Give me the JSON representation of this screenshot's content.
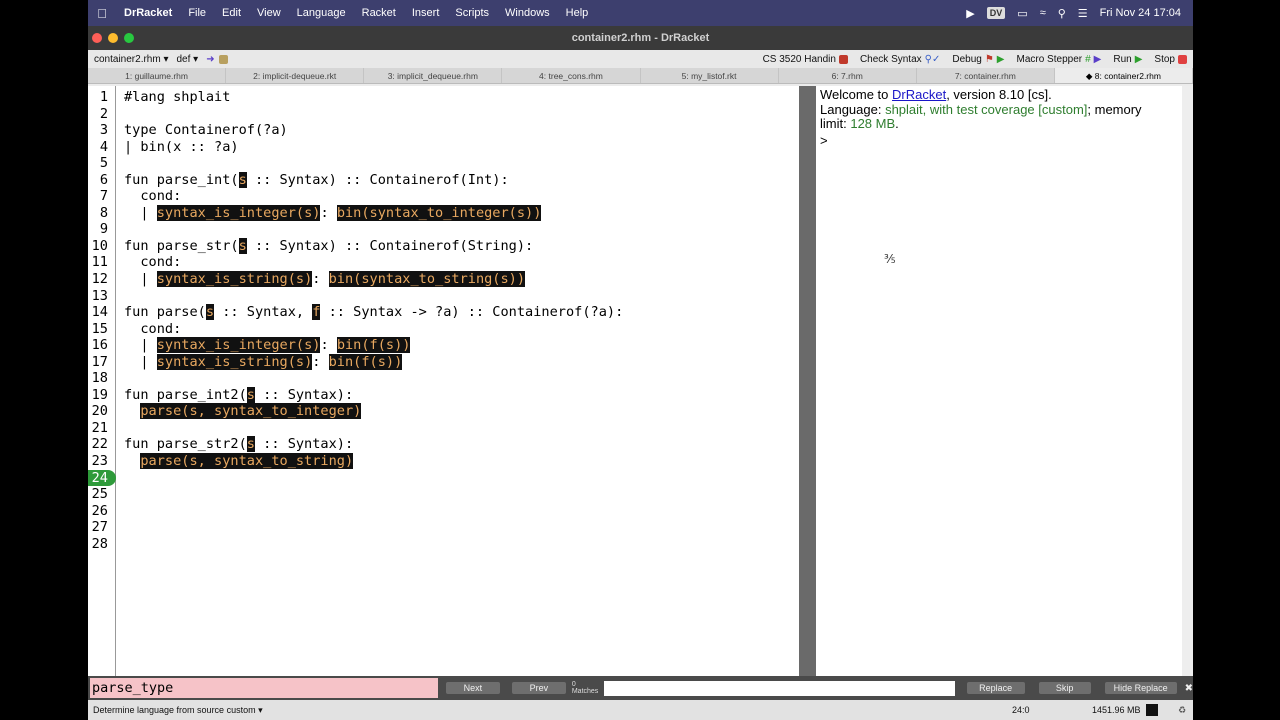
{
  "menubar": {
    "app": "DrRacket",
    "items": [
      "File",
      "Edit",
      "View",
      "Language",
      "Racket",
      "Insert",
      "Scripts",
      "Windows",
      "Help"
    ],
    "dv_badge": "DV",
    "clock": "Fri Nov 24  17:04"
  },
  "window": {
    "title": "container2.rhm - DrRacket"
  },
  "toolbar": {
    "file_menu": "container2.rhm ▾",
    "def_menu": "def ▾",
    "handin": "CS 3520 Handin",
    "check_syntax": "Check Syntax",
    "debug": "Debug",
    "macro_stepper": "Macro Stepper",
    "run": "Run",
    "stop": "Stop"
  },
  "tabs": [
    "1: guillaume.rhm",
    "2: implicit-dequeue.rkt",
    "3: implicit_dequeue.rhm",
    "4: tree_cons.rhm",
    "5: my_listof.rkt",
    "6: 7.rhm",
    "7: container.rhm",
    "◆ 8: container2.rhm"
  ],
  "editor": {
    "current_line": 24,
    "lines": [
      [
        {
          "t": "#lang shplait"
        }
      ],
      [],
      [
        {
          "t": "type Containerof(?a)"
        }
      ],
      [
        {
          "t": "| bin(x :: ?a)"
        }
      ],
      [],
      [
        {
          "t": "fun parse_int("
        },
        {
          "t": "s",
          "h": true
        },
        {
          "t": " :: Syntax) :: Containerof(Int):"
        }
      ],
      [
        {
          "t": "  cond:"
        }
      ],
      [
        {
          "t": "  | "
        },
        {
          "t": "syntax_is_integer(s)",
          "h": true
        },
        {
          "t": ": "
        },
        {
          "t": "bin(syntax_to_integer(s))",
          "h": true
        }
      ],
      [],
      [
        {
          "t": "fun parse_str("
        },
        {
          "t": "s",
          "h": true
        },
        {
          "t": " :: Syntax) :: Containerof(String):"
        }
      ],
      [
        {
          "t": "  cond:"
        }
      ],
      [
        {
          "t": "  | "
        },
        {
          "t": "syntax_is_string(s)",
          "h": true
        },
        {
          "t": ": "
        },
        {
          "t": "bin(syntax_to_string(s))",
          "h": true
        }
      ],
      [],
      [
        {
          "t": "fun parse("
        },
        {
          "t": "s",
          "h": true
        },
        {
          "t": " :: Syntax, "
        },
        {
          "t": "f",
          "h": true
        },
        {
          "t": " :: Syntax -> ?a) :: Containerof(?a):"
        }
      ],
      [
        {
          "t": "  cond:"
        }
      ],
      [
        {
          "t": "  | "
        },
        {
          "t": "syntax_is_integer(s)",
          "h": true
        },
        {
          "t": ": "
        },
        {
          "t": "bin(f(s))",
          "h": true
        }
      ],
      [
        {
          "t": "  | "
        },
        {
          "t": "syntax_is_string(s)",
          "h": true
        },
        {
          "t": ": "
        },
        {
          "t": "bin(f(s))",
          "h": true
        }
      ],
      [],
      [
        {
          "t": "fun parse_int2("
        },
        {
          "t": "s",
          "h": true
        },
        {
          "t": " :: Syntax):"
        }
      ],
      [
        {
          "t": "  "
        },
        {
          "t": "parse(s, syntax_to_integer)",
          "h": true
        }
      ],
      [],
      [
        {
          "t": "fun parse_str2("
        },
        {
          "t": "s",
          "h": true
        },
        {
          "t": " :: Syntax):"
        }
      ],
      [
        {
          "t": "  "
        },
        {
          "t": "parse(s, syntax_to_string)",
          "h": true
        }
      ],
      [],
      [],
      [],
      [],
      []
    ]
  },
  "repl": {
    "welcome_prefix": "Welcome to ",
    "welcome_link": "DrRacket",
    "welcome_suffix": ", version 8.10 [cs].",
    "lang_prefix": "Language: ",
    "lang_name": "shplait, with test coverage [custom]",
    "lang_mid": "; memory",
    "limit_prefix": "limit: ",
    "limit_value": "128 MB",
    "limit_suffix": ".",
    "prompt": ">"
  },
  "findbar": {
    "search_value": "parse_type",
    "next": "Next",
    "prev": "Prev",
    "match_count": "0",
    "matches_label": "Matches",
    "replace": "Replace",
    "skip": "Skip",
    "hide_replace": "Hide Replace"
  },
  "statusbar": {
    "language": "Determine language from source custom ▾",
    "position": "24:0",
    "memory": "1451.96 MB"
  }
}
